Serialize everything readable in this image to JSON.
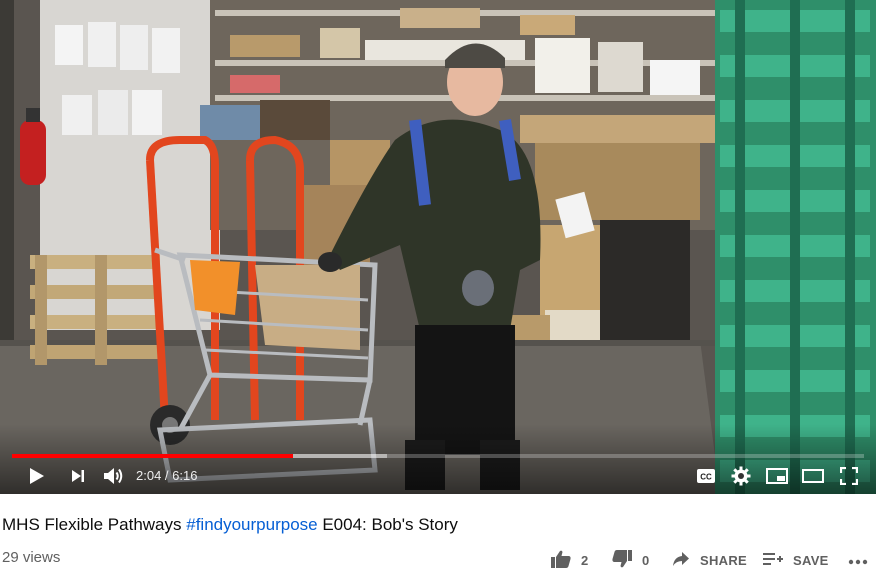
{
  "video": {
    "title_prefix": "MHS Flexible Pathways ",
    "title_hashtag": "#findyourpurpose",
    "title_suffix": " E004: Bob's Story",
    "views": "29 views",
    "current_time": "2:04",
    "duration": "6:16",
    "time_display": "2:04 / 6:16",
    "played_fraction": 0.33,
    "buffered_fraction": 0.44
  },
  "actions": {
    "like_count": "2",
    "dislike_count": "0",
    "share_label": "SHARE",
    "save_label": "SAVE"
  },
  "icons": {
    "play": "play-icon",
    "next": "next-icon",
    "volume": "volume-icon",
    "captions": "cc-icon",
    "settings": "gear-icon",
    "miniplayer": "miniplayer-icon",
    "theater": "theater-icon",
    "fullscreen": "fullscreen-icon",
    "like": "thumbs-up-icon",
    "dislike": "thumbs-down-icon",
    "share": "share-icon",
    "save": "save-playlist-icon",
    "more": "more-icon"
  },
  "colors": {
    "progress": "#ff0000",
    "hashtag": "#065fd4",
    "title": "#0d0d0d",
    "meta": "#606060"
  }
}
